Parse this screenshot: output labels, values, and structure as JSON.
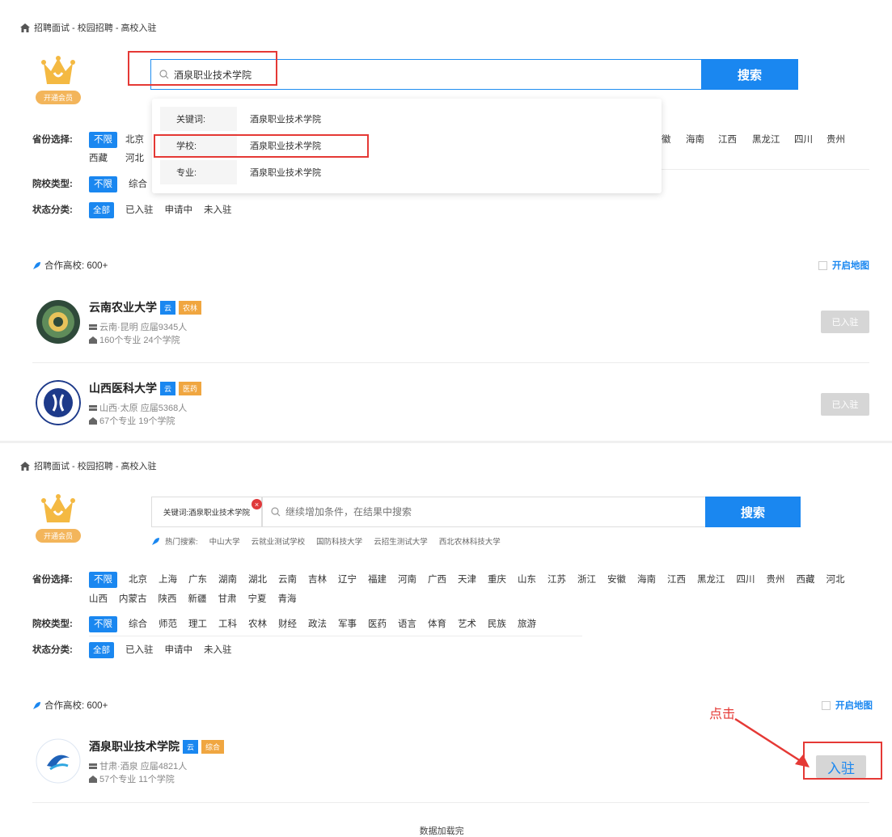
{
  "breadcrumb": "招聘面试 - 校园招聘 - 高校入驻",
  "member_badge": "开通会员",
  "panel1": {
    "search_value": "酒泉职业技术学院",
    "search_button": "搜索",
    "dropdown": [
      {
        "key": "关键词:",
        "value": "酒泉职业技术学院"
      },
      {
        "key": "学校:",
        "value": "酒泉职业技术学院"
      },
      {
        "key": "专业:",
        "value": "酒泉职业技术学院"
      }
    ],
    "province_label": "省份选择:",
    "province_active": "不限",
    "province_visible_left": [
      "北京"
    ],
    "province_visible_right": [
      "徽",
      "海南",
      "江西",
      "黑龙江",
      "四川",
      "贵州"
    ],
    "province_row2": [
      "西藏",
      "河北"
    ],
    "type_label": "院校类型:",
    "type_active": "不限",
    "type_visible": [
      "综合"
    ],
    "status_label": "状态分类:",
    "status_active": "全部",
    "status_items": [
      "已入驻",
      "申请中",
      "未入驻"
    ],
    "coop": "合作高校: 600+",
    "map": "开启地图",
    "schools": [
      {
        "name": "云南农业大学",
        "tag1": "云",
        "tag2": "农林",
        "loc": "云南·昆明 应届9345人",
        "stats": "160个专业 24个学院",
        "button": "已入驻"
      },
      {
        "name": "山西医科大学",
        "tag1": "云",
        "tag2": "医药",
        "loc": "山西·太原 应届5368人",
        "stats": "67个专业 19个学院",
        "button": "已入驻"
      }
    ]
  },
  "panel2": {
    "chip": "关键词:酒泉职业技术学院",
    "chip_close": "×",
    "search_placeholder": "继续增加条件，在结果中搜索",
    "search_button": "搜索",
    "hot_label": "热门搜索:",
    "hot_items": [
      "中山大学",
      "云就业测试学校",
      "国防科技大学",
      "云招生测试大学",
      "西北农林科技大学"
    ],
    "province_label": "省份选择:",
    "provinces": [
      "不限",
      "北京",
      "上海",
      "广东",
      "湖南",
      "湖北",
      "云南",
      "吉林",
      "辽宁",
      "福建",
      "河南",
      "广西",
      "天津",
      "重庆",
      "山东",
      "江苏",
      "浙江",
      "安徽",
      "海南",
      "江西",
      "黑龙江",
      "四川",
      "贵州",
      "西藏",
      "河北",
      "山西",
      "内蒙古",
      "陕西",
      "新疆",
      "甘肃",
      "宁夏",
      "青海"
    ],
    "type_label": "院校类型:",
    "types": [
      "不限",
      "综合",
      "师范",
      "理工",
      "工科",
      "农林",
      "财经",
      "政法",
      "军事",
      "医药",
      "语言",
      "体育",
      "艺术",
      "民族",
      "旅游"
    ],
    "status_label": "状态分类:",
    "statuses": [
      "全部",
      "已入驻",
      "申请中",
      "未入驻"
    ],
    "coop": "合作高校: 600+",
    "map": "开启地图",
    "click_note": "点击",
    "school": {
      "name": "酒泉职业技术学院",
      "tag1": "云",
      "tag2": "综合",
      "loc": "甘肃·酒泉 应届4821人",
      "stats": "57个专业 11个学院",
      "button": "入驻"
    },
    "loaded": "数据加载完啦"
  },
  "colors": {
    "primary": "#1a87f0",
    "annotation_red": "#e53935",
    "member_gold": "#f3b55b"
  }
}
